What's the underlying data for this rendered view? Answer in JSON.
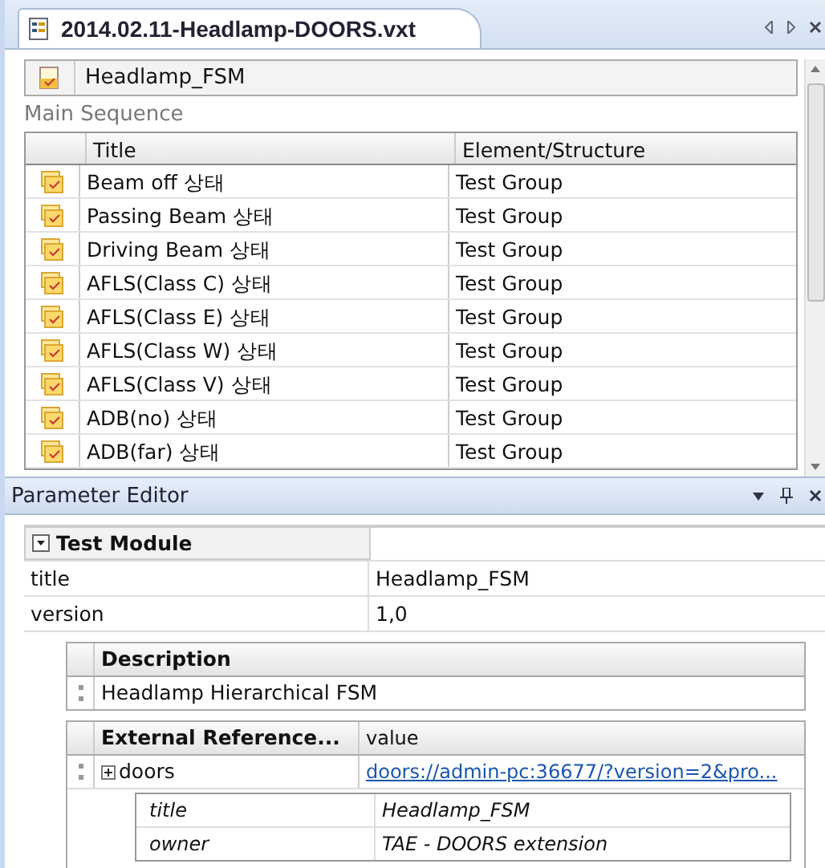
{
  "document_tab": {
    "title": "2014.02.11-Headlamp-DOORS.vxt"
  },
  "module": {
    "name": "Headlamp_FSM"
  },
  "section_label": "Main Sequence",
  "table": {
    "columns": [
      "Title",
      "Element/Structure"
    ],
    "rows": [
      {
        "title": "Beam off 상태",
        "element": "Test Group"
      },
      {
        "title": "Passing Beam 상태",
        "element": "Test Group"
      },
      {
        "title": "Driving Beam 상태",
        "element": "Test Group"
      },
      {
        "title": "AFLS(Class C) 상태",
        "element": "Test Group"
      },
      {
        "title": "AFLS(Class E) 상태",
        "element": "Test Group"
      },
      {
        "title": "AFLS(Class W) 상태",
        "element": "Test Group"
      },
      {
        "title": "AFLS(Class V) 상태",
        "element": "Test Group"
      },
      {
        "title": "ADB(no) 상태",
        "element": "Test Group"
      },
      {
        "title": "ADB(far) 상태",
        "element": "Test Group"
      }
    ]
  },
  "parameter_editor": {
    "title": "Parameter Editor",
    "module_header": "Test Module",
    "properties": [
      {
        "name": "title",
        "value": "Headlamp_FSM"
      },
      {
        "name": "version",
        "value": "1,0"
      }
    ],
    "description": {
      "header": "Description",
      "text": "Headlamp Hierarchical FSM"
    },
    "external_references": {
      "columns": [
        "External Reference...",
        "value"
      ],
      "rows": [
        {
          "name": "doors",
          "link": "doors://admin-pc:36677/?version=2&pro...",
          "details": [
            {
              "name": "title",
              "value": "Headlamp_FSM"
            },
            {
              "name": "owner",
              "value": "TAE - DOORS extension"
            }
          ]
        }
      ]
    }
  }
}
